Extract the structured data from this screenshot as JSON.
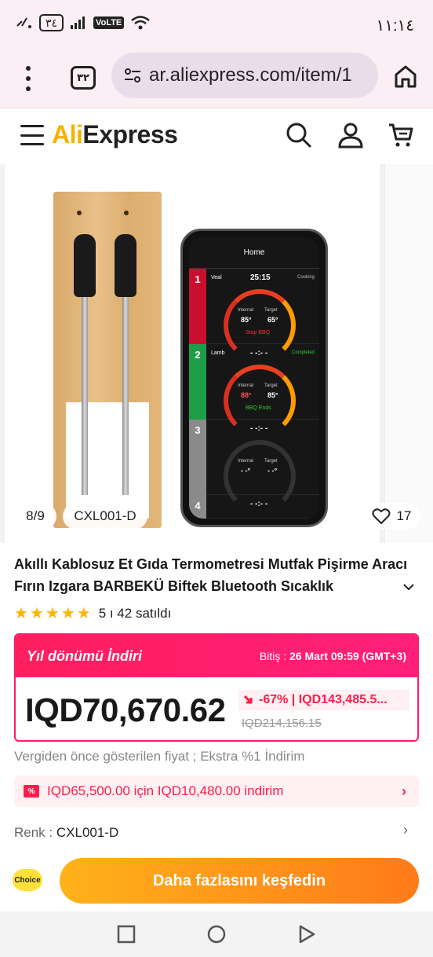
{
  "status_bar": {
    "time": "١١:١٤",
    "battery": "٣٤",
    "network": "VoLTE"
  },
  "browser": {
    "tab_count": "٣٢",
    "url": "ar.aliexpress.com/item/1"
  },
  "header": {
    "logo_prefix": "Ali",
    "logo_suffix": "Express"
  },
  "gallery": {
    "image_counter": "8/9",
    "variant_badge": "CXL001-D",
    "wishlist_count": "17",
    "app_screen": {
      "title": "Home",
      "channels": [
        {
          "num": "1",
          "name": "Veal",
          "time": "25:15",
          "status": "Cooking",
          "internal_label": "Internal",
          "target_label": "Target",
          "internal": "85°",
          "target": "65°",
          "message": "Stop BBQ"
        },
        {
          "num": "2",
          "name": "Lamb",
          "time": "- -:- -",
          "status": "Completed",
          "internal_label": "Internal",
          "target_label": "Target",
          "internal": "88°",
          "target": "85°",
          "message": "BBQ Ends"
        },
        {
          "num": "3",
          "name": "",
          "time": "- -:- -",
          "status": "",
          "internal_label": "Internal",
          "target_label": "Target",
          "internal": "- -°",
          "target": "- -°",
          "message": ""
        },
        {
          "num": "4",
          "name": "",
          "time": "- -:- -",
          "status": "",
          "internal_label": "",
          "target_label": "",
          "internal": "",
          "target": "",
          "message": ""
        }
      ]
    }
  },
  "product": {
    "title": "Akıllı Kablosuz Et Gıda Termometresi Mutfak Pişirme Aracı Fırın Izgara BARBEKÜ Biftek Bluetooth Sıcaklık",
    "rating_stars": 5,
    "rating_text": "5 ı 42 satıldı"
  },
  "deal": {
    "title": "Yıl dönümü İndiri",
    "ends_label": "Bitiş :",
    "ends_value": "26 Mart 09:59 (GMT+3)",
    "price": "IQD70,670.62",
    "discount": "-67% | IQD143,485.5...",
    "original_price": "IQD214,156.15"
  },
  "tax_note": "Vergiden önce gösterilen fiyat ; Ekstra %1 İndirim",
  "coupon": {
    "text": "IQD65,500.00 için IQD10,480.00 indirim"
  },
  "color": {
    "label": "Renk :",
    "value": "CXL001-D"
  },
  "cta": {
    "choice_label": "Choice",
    "button_label": "Daha fazlasını keşfedin"
  },
  "colors": {
    "accent": "#ff1c6a",
    "cta_start": "#ffb21a",
    "cta_end": "#ff7a1a",
    "star": "#ffb400"
  }
}
